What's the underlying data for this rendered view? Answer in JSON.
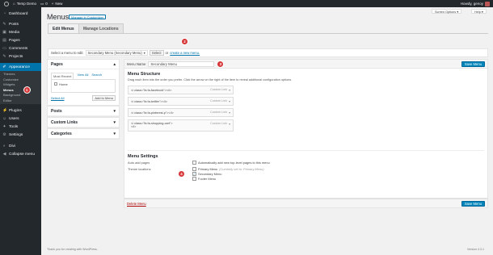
{
  "admin_bar": {
    "site_name": "Temp Demo",
    "comments_count": "0",
    "new_label": "New",
    "greeting": "Howdy, genoy"
  },
  "sidebar": {
    "items": [
      {
        "label": "Dashboard",
        "icon": "dashboard-icon"
      },
      {
        "label": "Posts",
        "icon": "pin-icon"
      },
      {
        "label": "Media",
        "icon": "media-icon"
      },
      {
        "label": "Pages",
        "icon": "page-icon"
      },
      {
        "label": "Comments",
        "icon": "comment-icon"
      },
      {
        "label": "Projects",
        "icon": "pin-icon"
      }
    ],
    "appearance": "Appearance",
    "sub_items": [
      "Themes",
      "Customize",
      "Widgets",
      "Menus",
      "Background",
      "Editor"
    ],
    "items_after": [
      {
        "label": "Plugins",
        "icon": "plugin-icon"
      },
      {
        "label": "Users",
        "icon": "users-icon"
      },
      {
        "label": "Tools",
        "icon": "tools-icon"
      },
      {
        "label": "Settings",
        "icon": "settings-icon"
      }
    ],
    "divi": "Divi",
    "collapse": "Collapse menu"
  },
  "header": {
    "screen_options": "Screen Options ▾",
    "help": "Help ▾",
    "title": "Menus",
    "manage_customizer": "Manage in Customizer"
  },
  "tabs": {
    "edit": "Edit Menus",
    "locations": "Manage Locations"
  },
  "select_bar": {
    "prefix": "Select a menu to edit:",
    "selected": "Secondary Menu (Secondary Menu)",
    "select_btn": "Select",
    "or": "or",
    "create_link": "create a new menu."
  },
  "annotations": {
    "a1": "1",
    "a2": "2",
    "a3": "3",
    "a4": "4"
  },
  "left_panels": {
    "pages": {
      "title": "Pages",
      "tab_recent": "Most Recent",
      "tab_all": "View All",
      "tab_search": "Search",
      "item": "Home",
      "select_all": "Select All",
      "add_btn": "Add to Menu"
    },
    "posts": "Posts",
    "custom_links": "Custom Links",
    "categories": "Categories"
  },
  "menu_name": {
    "label": "Menu Name",
    "value": "Secondary Menu",
    "save": "Save Menu"
  },
  "structure": {
    "title": "Menu Structure",
    "desc": "Drag each item into the order you prefer. Click the arrow on the right of the item to reveal additional configuration options.",
    "items": [
      {
        "title": "<i class=\"fa fa-facebook\"></i>",
        "type": "Custom Link"
      },
      {
        "title": "<i class=\"fa fa-twitter\"></i>",
        "type": "Custom Link"
      },
      {
        "title": "<i class=\"fa fa-pinterest-p\"></i>",
        "type": "Custom Link"
      },
      {
        "title": "<i class=\"fa fa-shopping-cart\">",
        "title2": "</i>",
        "type": "Custom Link"
      }
    ]
  },
  "settings": {
    "title": "Menu Settings",
    "auto_add_label": "Auto add pages",
    "auto_add_text": "Automatically add new top-level pages to this menu",
    "locations_label": "Theme locations",
    "locations": [
      {
        "name": "Primary Menu",
        "note": "(Currently set to: Primary Menu)",
        "checked": false
      },
      {
        "name": "Secondary Menu",
        "note": "",
        "checked": true
      },
      {
        "name": "Footer Menu",
        "note": "",
        "checked": false
      }
    ],
    "delete": "Delete Menu",
    "save": "Save Menu"
  },
  "footer": {
    "left": "Thank you for creating with WordPress.",
    "right": "Version 4.3.1"
  },
  "colors": {
    "admin_dark": "#23282d",
    "active_blue": "#0073aa",
    "button_blue": "#0085ba",
    "annotation_red": "#d63638"
  }
}
